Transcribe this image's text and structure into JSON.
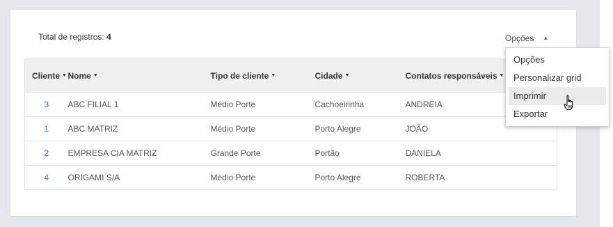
{
  "summary": {
    "total_label": "Total de registros:",
    "total_value": "4"
  },
  "options_trigger": {
    "label": "Opções",
    "caret": "▲"
  },
  "table": {
    "columns": [
      {
        "label": "Cliente",
        "sort_icon": "▼"
      },
      {
        "label": "Nome",
        "sort_icon": "▼"
      },
      {
        "label": "Tipo de cliente",
        "sort_icon": "▼"
      },
      {
        "label": "Cidade",
        "sort_icon": "▼"
      },
      {
        "label": "Contatos responsáveis",
        "sort_icon": "▼"
      }
    ],
    "rows": [
      {
        "cliente": "3",
        "nome": "ABC FILIAL 1",
        "tipo": "Médio Porte",
        "cidade": "Cachoeirinha",
        "contato": "ANDREIA"
      },
      {
        "cliente": "1",
        "nome": "ABC MATRIZ",
        "tipo": "Médio Porte",
        "cidade": "Porto Alegre",
        "contato": "JOÃO"
      },
      {
        "cliente": "2",
        "nome": "EMPRESA CIA MATRIZ",
        "tipo": "Grande Porte",
        "cidade": "Portão",
        "contato": "DANIELA"
      },
      {
        "cliente": "4",
        "nome": "ORIGAMI S/A",
        "tipo": "Médio Porte",
        "cidade": "Porto Alegre",
        "contato": "ROBERTA"
      }
    ]
  },
  "dropdown": {
    "items": [
      {
        "label": "Opções"
      },
      {
        "label": "Personalizar grid"
      },
      {
        "label": "Imprimir",
        "hovered": true
      },
      {
        "label": "Exportar"
      }
    ]
  },
  "colors": {
    "link": "#2a7ab8",
    "header_bg": "#efefef",
    "page_bg": "#e4e8ec",
    "hover_bg": "#ebebeb"
  },
  "icons": {
    "pointer": "hand-pointer-icon",
    "sort": "sort-down-icon",
    "options_caret": "caret-up-icon"
  }
}
